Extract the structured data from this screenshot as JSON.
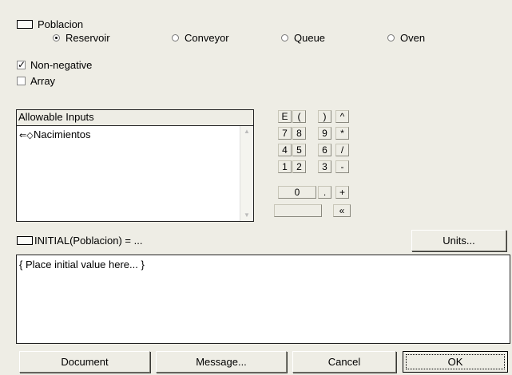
{
  "stock": {
    "name": "Poblacion"
  },
  "stock_types": [
    {
      "label": "Reservoir",
      "selected": true
    },
    {
      "label": "Conveyor",
      "selected": false
    },
    {
      "label": "Queue",
      "selected": false
    },
    {
      "label": "Oven",
      "selected": false
    }
  ],
  "options": {
    "non_negative": {
      "label": "Non-negative",
      "checked": true
    },
    "array": {
      "label": "Array",
      "checked": false
    }
  },
  "inputs": {
    "header": "Allowable Inputs",
    "items": [
      {
        "icon": "converter-flow-icon",
        "label": "Nacimientos"
      }
    ]
  },
  "keypad": {
    "rows": [
      [
        "E",
        "(",
        ")",
        "^"
      ],
      [
        "7",
        "8",
        "9",
        "*"
      ],
      [
        "4",
        "5",
        "6",
        "/"
      ],
      [
        "1",
        "2",
        "3",
        "-"
      ],
      [
        "0",
        ".",
        "+"
      ],
      [
        "«"
      ]
    ]
  },
  "equation": {
    "label": "INITIAL(Poblacion) = ...",
    "value": "{ Place initial value here... }"
  },
  "buttons": {
    "units": "Units...",
    "document": "Document",
    "message": "Message...",
    "cancel": "Cancel",
    "ok": "OK"
  }
}
